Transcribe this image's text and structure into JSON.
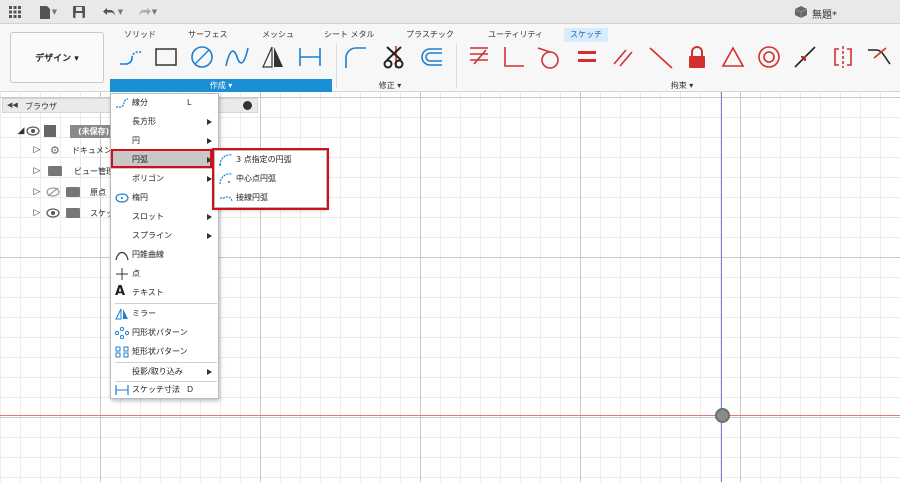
{
  "app": {
    "doc_title": "無題*"
  },
  "design_button": "デザイン ▾",
  "tabs": [
    {
      "label": "ソリッド",
      "active": false
    },
    {
      "label": "サーフェス",
      "active": false
    },
    {
      "label": "メッシュ",
      "active": false
    },
    {
      "label": "シート メタル",
      "active": false
    },
    {
      "label": "プラスチック",
      "active": false
    },
    {
      "label": "ユーティリティ",
      "active": false
    },
    {
      "label": "スケッチ",
      "active": true
    }
  ],
  "groups": {
    "create": "作成 ▾",
    "modify": "修正 ▾",
    "constraints": "拘束 ▾"
  },
  "browser": {
    "title": "ブラウザ",
    "nodes": [
      {
        "label": "(未保存)"
      },
      {
        "label": "ドキュメント"
      },
      {
        "label": "ビュー管理"
      },
      {
        "label": "原点"
      },
      {
        "label": "スケッチ"
      }
    ]
  },
  "create_menu": {
    "items": [
      {
        "label": "線分",
        "shortcut": "L",
        "submenu": false
      },
      {
        "label": "長方形",
        "shortcut": "",
        "submenu": true
      },
      {
        "label": "円",
        "shortcut": "",
        "submenu": true
      },
      {
        "label": "円弧",
        "shortcut": "",
        "submenu": true,
        "highlighted": true
      },
      {
        "label": "ポリゴン",
        "shortcut": "",
        "submenu": true
      },
      {
        "label": "楕円",
        "shortcut": "",
        "submenu": false
      },
      {
        "label": "スロット",
        "shortcut": "",
        "submenu": true
      },
      {
        "label": "スプライン",
        "shortcut": "",
        "submenu": true
      },
      {
        "label": "円錐曲線",
        "shortcut": "",
        "submenu": false
      },
      {
        "label": "点",
        "shortcut": "",
        "submenu": false
      },
      {
        "label": "テキスト",
        "shortcut": "",
        "submenu": false
      },
      {
        "label": "ミラー",
        "shortcut": "",
        "submenu": false
      },
      {
        "label": "円形状パターン",
        "shortcut": "",
        "submenu": false
      },
      {
        "label": "矩形状パターン",
        "shortcut": "",
        "submenu": false
      },
      {
        "label": "投影/取り込み",
        "shortcut": "",
        "submenu": true
      },
      {
        "label": "スケッチ寸法",
        "shortcut": "D",
        "submenu": false
      }
    ]
  },
  "arc_submenu": {
    "items": [
      {
        "label": "3 点指定の円弧"
      },
      {
        "label": "中心点円弧"
      },
      {
        "label": "接線円弧"
      }
    ]
  },
  "colors": {
    "accent": "#1b8fd6",
    "highlight_border": "#d0101a",
    "constraint_red": "#d23030",
    "axis_x": "#e07a7a",
    "axis_y": "#7b7bd6"
  }
}
